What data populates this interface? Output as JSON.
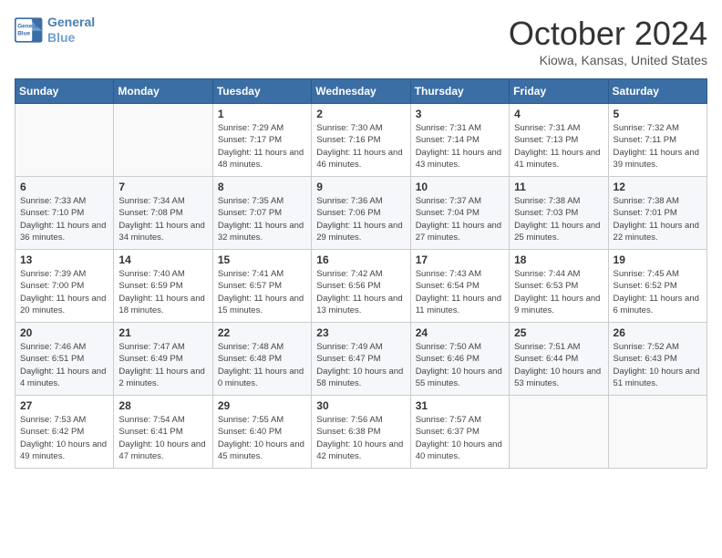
{
  "header": {
    "logo_line1": "General",
    "logo_line2": "Blue",
    "month_title": "October 2024",
    "location": "Kiowa, Kansas, United States"
  },
  "weekdays": [
    "Sunday",
    "Monday",
    "Tuesday",
    "Wednesday",
    "Thursday",
    "Friday",
    "Saturday"
  ],
  "weeks": [
    [
      {
        "day": "",
        "info": ""
      },
      {
        "day": "",
        "info": ""
      },
      {
        "day": "1",
        "info": "Sunrise: 7:29 AM\nSunset: 7:17 PM\nDaylight: 11 hours and 48 minutes."
      },
      {
        "day": "2",
        "info": "Sunrise: 7:30 AM\nSunset: 7:16 PM\nDaylight: 11 hours and 46 minutes."
      },
      {
        "day": "3",
        "info": "Sunrise: 7:31 AM\nSunset: 7:14 PM\nDaylight: 11 hours and 43 minutes."
      },
      {
        "day": "4",
        "info": "Sunrise: 7:31 AM\nSunset: 7:13 PM\nDaylight: 11 hours and 41 minutes."
      },
      {
        "day": "5",
        "info": "Sunrise: 7:32 AM\nSunset: 7:11 PM\nDaylight: 11 hours and 39 minutes."
      }
    ],
    [
      {
        "day": "6",
        "info": "Sunrise: 7:33 AM\nSunset: 7:10 PM\nDaylight: 11 hours and 36 minutes."
      },
      {
        "day": "7",
        "info": "Sunrise: 7:34 AM\nSunset: 7:08 PM\nDaylight: 11 hours and 34 minutes."
      },
      {
        "day": "8",
        "info": "Sunrise: 7:35 AM\nSunset: 7:07 PM\nDaylight: 11 hours and 32 minutes."
      },
      {
        "day": "9",
        "info": "Sunrise: 7:36 AM\nSunset: 7:06 PM\nDaylight: 11 hours and 29 minutes."
      },
      {
        "day": "10",
        "info": "Sunrise: 7:37 AM\nSunset: 7:04 PM\nDaylight: 11 hours and 27 minutes."
      },
      {
        "day": "11",
        "info": "Sunrise: 7:38 AM\nSunset: 7:03 PM\nDaylight: 11 hours and 25 minutes."
      },
      {
        "day": "12",
        "info": "Sunrise: 7:38 AM\nSunset: 7:01 PM\nDaylight: 11 hours and 22 minutes."
      }
    ],
    [
      {
        "day": "13",
        "info": "Sunrise: 7:39 AM\nSunset: 7:00 PM\nDaylight: 11 hours and 20 minutes."
      },
      {
        "day": "14",
        "info": "Sunrise: 7:40 AM\nSunset: 6:59 PM\nDaylight: 11 hours and 18 minutes."
      },
      {
        "day": "15",
        "info": "Sunrise: 7:41 AM\nSunset: 6:57 PM\nDaylight: 11 hours and 15 minutes."
      },
      {
        "day": "16",
        "info": "Sunrise: 7:42 AM\nSunset: 6:56 PM\nDaylight: 11 hours and 13 minutes."
      },
      {
        "day": "17",
        "info": "Sunrise: 7:43 AM\nSunset: 6:54 PM\nDaylight: 11 hours and 11 minutes."
      },
      {
        "day": "18",
        "info": "Sunrise: 7:44 AM\nSunset: 6:53 PM\nDaylight: 11 hours and 9 minutes."
      },
      {
        "day": "19",
        "info": "Sunrise: 7:45 AM\nSunset: 6:52 PM\nDaylight: 11 hours and 6 minutes."
      }
    ],
    [
      {
        "day": "20",
        "info": "Sunrise: 7:46 AM\nSunset: 6:51 PM\nDaylight: 11 hours and 4 minutes."
      },
      {
        "day": "21",
        "info": "Sunrise: 7:47 AM\nSunset: 6:49 PM\nDaylight: 11 hours and 2 minutes."
      },
      {
        "day": "22",
        "info": "Sunrise: 7:48 AM\nSunset: 6:48 PM\nDaylight: 11 hours and 0 minutes."
      },
      {
        "day": "23",
        "info": "Sunrise: 7:49 AM\nSunset: 6:47 PM\nDaylight: 10 hours and 58 minutes."
      },
      {
        "day": "24",
        "info": "Sunrise: 7:50 AM\nSunset: 6:46 PM\nDaylight: 10 hours and 55 minutes."
      },
      {
        "day": "25",
        "info": "Sunrise: 7:51 AM\nSunset: 6:44 PM\nDaylight: 10 hours and 53 minutes."
      },
      {
        "day": "26",
        "info": "Sunrise: 7:52 AM\nSunset: 6:43 PM\nDaylight: 10 hours and 51 minutes."
      }
    ],
    [
      {
        "day": "27",
        "info": "Sunrise: 7:53 AM\nSunset: 6:42 PM\nDaylight: 10 hours and 49 minutes."
      },
      {
        "day": "28",
        "info": "Sunrise: 7:54 AM\nSunset: 6:41 PM\nDaylight: 10 hours and 47 minutes."
      },
      {
        "day": "29",
        "info": "Sunrise: 7:55 AM\nSunset: 6:40 PM\nDaylight: 10 hours and 45 minutes."
      },
      {
        "day": "30",
        "info": "Sunrise: 7:56 AM\nSunset: 6:38 PM\nDaylight: 10 hours and 42 minutes."
      },
      {
        "day": "31",
        "info": "Sunrise: 7:57 AM\nSunset: 6:37 PM\nDaylight: 10 hours and 40 minutes."
      },
      {
        "day": "",
        "info": ""
      },
      {
        "day": "",
        "info": ""
      }
    ]
  ]
}
